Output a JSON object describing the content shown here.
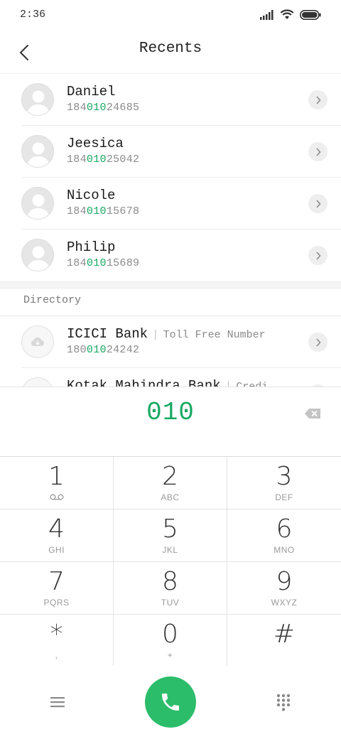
{
  "status_bar": {
    "time": "2:36"
  },
  "header": {
    "title": "Recents"
  },
  "recents": [
    {
      "name": "Daniel",
      "number_pre": "184",
      "number_match": "010",
      "number_post": "24685"
    },
    {
      "name": "Jeesica",
      "number_pre": "184",
      "number_match": "010",
      "number_post": "25042"
    },
    {
      "name": "Nicole",
      "number_pre": "184",
      "number_match": "010",
      "number_post": "15678"
    },
    {
      "name": "Philip",
      "number_pre": "184",
      "number_match": "010",
      "number_post": "15689"
    }
  ],
  "directory": {
    "label": "Directory",
    "items": [
      {
        "name": "ICICI Bank",
        "separator": "|",
        "subtitle": "Toll Free Number",
        "number_pre": "180",
        "number_match": "010",
        "number_post": "24242"
      },
      {
        "name": "Kotak Mahindra Bank",
        "separator": "|",
        "subtitle": "Credi"
      }
    ]
  },
  "dialer": {
    "value": "010",
    "keys": [
      {
        "digit": "1",
        "letters": ""
      },
      {
        "digit": "2",
        "letters": "ABC"
      },
      {
        "digit": "3",
        "letters": "DEF"
      },
      {
        "digit": "4",
        "letters": "GHI"
      },
      {
        "digit": "5",
        "letters": "JKL"
      },
      {
        "digit": "6",
        "letters": "MNO"
      },
      {
        "digit": "7",
        "letters": "PQRS"
      },
      {
        "digit": "8",
        "letters": "TUV"
      },
      {
        "digit": "9",
        "letters": "WXYZ"
      },
      {
        "digit": "*",
        "letters": ","
      },
      {
        "digit": "0",
        "letters": "+"
      },
      {
        "digit": "#",
        "letters": ""
      }
    ]
  },
  "icons": {
    "back": "back-arrow-icon",
    "chevron": "chevron-right-icon",
    "backspace": "backspace-icon",
    "voicemail": "voicemail-icon",
    "menu": "menu-icon",
    "call": "phone-icon",
    "keypad": "dialpad-icon"
  },
  "colors": {
    "accent": "#17a862",
    "call_button": "#2bbd6a"
  }
}
